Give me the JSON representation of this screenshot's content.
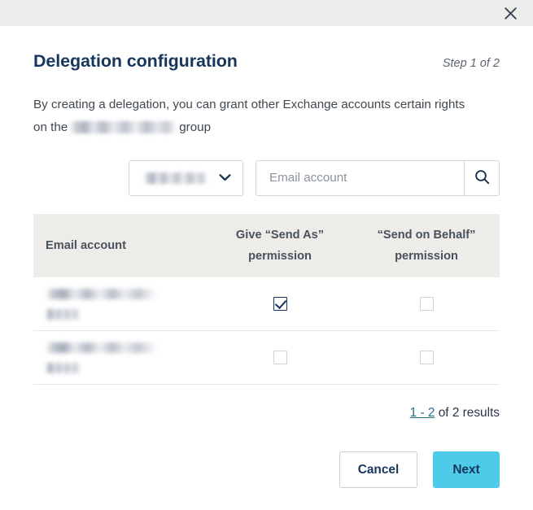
{
  "titlebar": {
    "close_icon": "close-icon"
  },
  "header": {
    "title": "Delegation configuration",
    "step": "Step 1 of 2"
  },
  "description": {
    "part1": "By creating a delegation, you can grant other Exchange accounts certain rights on the",
    "group_name": "",
    "part2": "group"
  },
  "controls": {
    "domain_select": {
      "value": "",
      "chevron_icon": "chevron-down-icon"
    },
    "search": {
      "value": "",
      "placeholder": "Email account",
      "button_icon": "search-icon"
    }
  },
  "table": {
    "columns": [
      "Email account",
      "Give “Send As” permission",
      "“Send on Behalf” permission"
    ],
    "rows": [
      {
        "email_line1": "",
        "email_line2": "",
        "send_as": true,
        "send_on_behalf": false
      },
      {
        "email_line1": "",
        "email_line2": "",
        "send_as": false,
        "send_on_behalf": false
      }
    ]
  },
  "pagination": {
    "range": "1 - 2",
    "suffix": "of 2 results"
  },
  "footer": {
    "cancel_label": "Cancel",
    "next_label": "Next"
  },
  "colors": {
    "titlebar_bg": "#ececeb",
    "title_text": "#16365c",
    "table_header_bg": "#edece9",
    "link": "#1f6f85",
    "primary_button_bg": "#4ecbe8",
    "checkbox_checked": "#16365c"
  }
}
